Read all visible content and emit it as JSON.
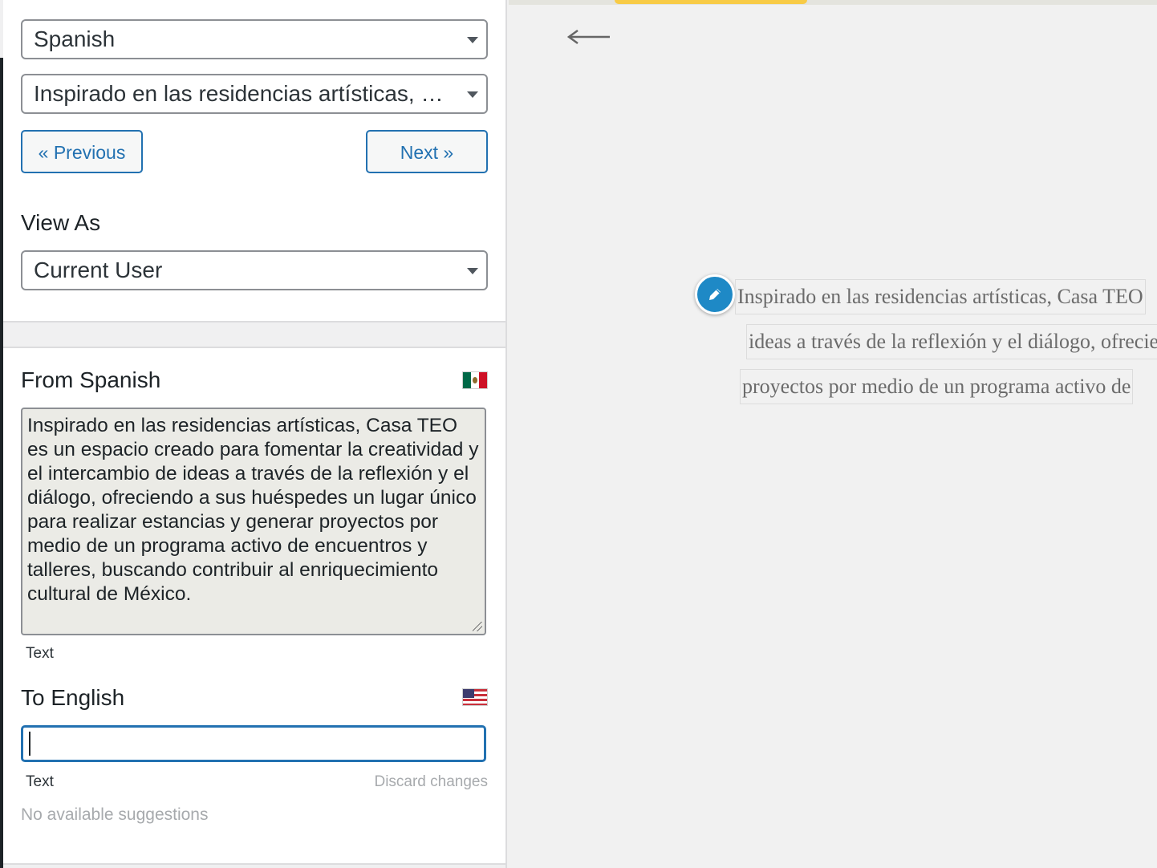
{
  "language_select": {
    "value": "Spanish"
  },
  "string_select": {
    "value": "Inspirado en las residencias artísticas, Casa TEO es un espacio creado para fomentar la creatividad y el intercambio de ideas a través de la reflexión y el diálogo, ofreciendo a sus huéspedes un lugar único para realizar estancias y generar proyectos por medio de un programa activo de encuentros y talleres, buscando contribuir al enriquecimiento cultural de México."
  },
  "nav": {
    "previous_label": "« Previous",
    "next_label": "Next »"
  },
  "view_as": {
    "label": "View As",
    "value": "Current User"
  },
  "from": {
    "label": "From Spanish",
    "flag": "mexico-flag-icon",
    "text": "Inspirado en las residencias artísticas, Casa TEO es un espacio creado para fomentar la creatividad y el intercambio de ideas a través de la reflexión y el diálogo, ofreciendo a sus huéspedes un lugar único para realizar estancias y generar proyectos por medio de un programa activo de encuentros y talleres, buscando contribuir al enriquecimiento cultural de México.",
    "type_label": "Text"
  },
  "to": {
    "label": "To English",
    "flag": "usa-flag-icon",
    "value": "",
    "type_label": "Text",
    "discard_label": "Discard changes",
    "suggestions_text": "No available suggestions"
  },
  "preview": {
    "lines": [
      "Inspirado en las residencias artísticas, Casa TEO",
      "ideas a través de la reflexión y el diálogo, ofreciendo",
      "proyectos por medio de un programa activo de"
    ]
  },
  "colors": {
    "accent": "#2271b1",
    "pencil": "#1e89c6",
    "source_bg": "#ebebe6",
    "muted": "#a7aaad"
  }
}
